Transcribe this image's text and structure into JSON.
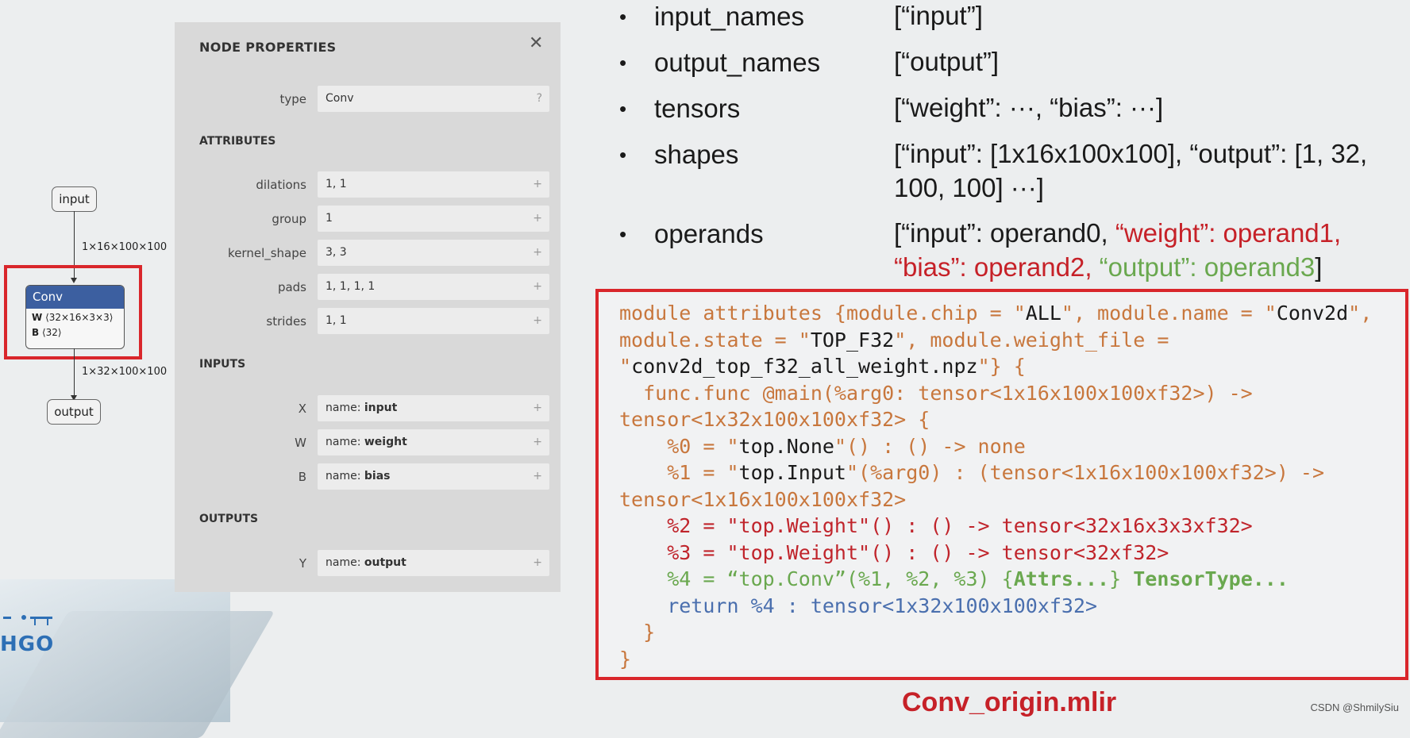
{
  "graph": {
    "input_node": "input",
    "output_node": "output",
    "edge_in_label": "1×16×100×100",
    "edge_out_label": "1×32×100×100",
    "conv": {
      "title": "Conv",
      "w_label": "W",
      "w_shape": "⟨32×16×3×3⟩",
      "b_label": "B",
      "b_shape": "⟨32⟩"
    }
  },
  "panel": {
    "title": "NODE PROPERTIES",
    "close_icon": "close-icon",
    "type_label": "type",
    "type_value": "Conv",
    "type_help": "?",
    "attributes_title": "ATTRIBUTES",
    "attributes": [
      {
        "label": "dilations",
        "value": "1, 1"
      },
      {
        "label": "group",
        "value": "1"
      },
      {
        "label": "kernel_shape",
        "value": "3, 3"
      },
      {
        "label": "pads",
        "value": "1, 1, 1, 1"
      },
      {
        "label": "strides",
        "value": "1, 1"
      }
    ],
    "inputs_title": "INPUTS",
    "inputs": [
      {
        "label": "X",
        "prefix": "name: ",
        "value": "input"
      },
      {
        "label": "W",
        "prefix": "name: ",
        "value": "weight"
      },
      {
        "label": "B",
        "prefix": "name: ",
        "value": "bias"
      }
    ],
    "outputs_title": "OUTPUTS",
    "outputs": [
      {
        "label": "Y",
        "prefix": "name: ",
        "value": "output"
      }
    ],
    "plus": "+"
  },
  "bullets": [
    {
      "key": "input_names",
      "value": "[“input”]"
    },
    {
      "key": "output_names",
      "value": "[“output”]"
    },
    {
      "key": "tensors",
      "value": "[“weight”: ···, “bias”: ···]"
    },
    {
      "key": "shapes",
      "value_line1": "[“input”: [1x16x100x100], “output”: [1, 32,",
      "value_line2": "100, 100] ···]"
    },
    {
      "key": "operands",
      "v1": "[“input”: operand0, ",
      "v2": "“weight”: operand1,",
      "v3": "“bias”: operand2, ",
      "v4": "“output”: operand3",
      "v5": "]"
    }
  ],
  "code": {
    "l1a": "module attributes {module.chip = \"",
    "l1b": "ALL",
    "l1c": "\", module.name = \"",
    "l1d": "Conv2d",
    "l1e": "\",",
    "l2a": "module.state = \"",
    "l2b": "TOP_F32",
    "l2c": "\", module.weight_file =",
    "l3a": "\"",
    "l3b": "conv2d_top_f32_all_weight.npz",
    "l3c": "\"} {",
    "l4": "  func.func @main(%arg0: tensor<1x16x100x100xf32>) ->",
    "l5": "tensor<1x32x100x100xf32> {",
    "l6a": "    %0 = \"",
    "l6b": "top.None",
    "l6c": "\"() : () -> none",
    "l7a": "    %1 = \"",
    "l7b": "top.Input",
    "l7c": "\"(%arg0) : (tensor<1x16x100x100xf32>) ->",
    "l8": "tensor<1x16x100x100xf32>",
    "l9": "    %2 = \"top.Weight\"() : () -> tensor<32x16x3x3xf32>",
    "l10": "    %3 = \"top.Weight\"() : () -> tensor<32xf32>",
    "l11a": "    %4 = “top.Conv”(%1, %2, %3) {",
    "l11b": "Attrs...",
    "l11c": "} ",
    "l11d": "TensorType...",
    "l12": "    return %4 : tensor<1x32x100x100xf32>",
    "l13": "  }",
    "l14": "}"
  },
  "caption": "Conv_origin.mlir",
  "watermark": "CSDN @ShmilySiu",
  "logo_text": "HGO"
}
